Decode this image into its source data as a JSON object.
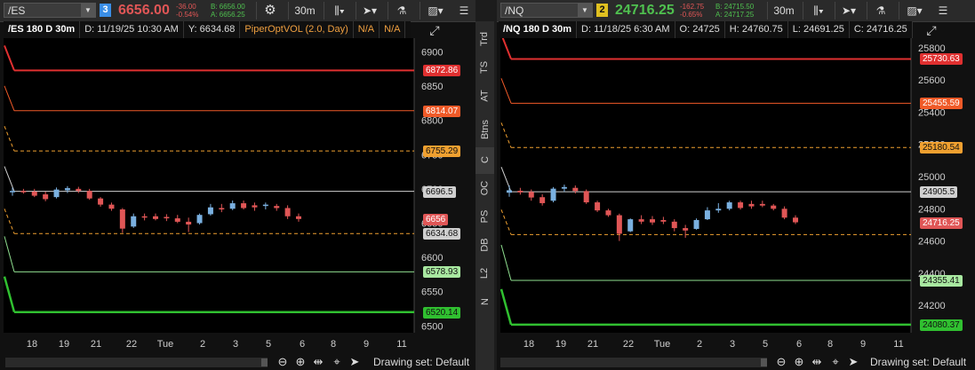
{
  "left": {
    "symbol": "/ES",
    "link_number": "3",
    "price": "6656.00",
    "change": "-36.00",
    "change_pct": "-0.54%",
    "bid": "B: 6656.00",
    "ask": "A: 6656.25",
    "timeframe": "30m",
    "info_title": "/ES 180 D 30m",
    "info_date": "D: 11/19/25 10:30 AM",
    "info_extra": "Y: 6634.68",
    "info_study": "PiperOptVOL (2.0, Day)",
    "info_na1": "N/A",
    "info_na2": "N/A",
    "y_ticks": [
      "6900",
      "6850",
      "6800",
      "6750",
      "6700",
      "6650",
      "6600",
      "6550",
      "6500"
    ],
    "x_ticks": [
      "18",
      "19",
      "21",
      "22",
      "Tue",
      "2",
      "3",
      "5",
      "6",
      "8",
      "9",
      "11"
    ],
    "price_tags": [
      "6872.86",
      "6814.07",
      "6755.29",
      "6696.5",
      "6656",
      "6634.68",
      "6578.93",
      "6520.14"
    ],
    "drawing_set": "Drawing set: Default"
  },
  "right": {
    "symbol": "/NQ",
    "link_number": "2",
    "price": "24716.25",
    "change": "-162.75",
    "change_pct": "-0.65%",
    "bid": "B: 24715.50",
    "ask": "A: 24717.25",
    "timeframe": "30m",
    "info_title": "/NQ 180 D 30m",
    "info_date": "D: 11/18/25 6:30 AM",
    "info_o": "O: 24725",
    "info_h": "H: 24760.75",
    "info_l": "L: 24691.25",
    "info_c": "C: 24716.25",
    "y_ticks": [
      "25800",
      "25600",
      "25400",
      "25200",
      "25000",
      "24800",
      "24600",
      "24400",
      "24200"
    ],
    "x_ticks": [
      "18",
      "19",
      "21",
      "22",
      "Tue",
      "2",
      "3",
      "5",
      "6",
      "8",
      "9",
      "11"
    ],
    "price_tags": [
      "25730.63",
      "25455.59",
      "25180.54",
      "24905.5",
      "24716.25",
      "24355.41",
      "24080.37"
    ],
    "drawing_set": "Drawing set: Default"
  },
  "side_tabs": [
    "Trd",
    "TS",
    "AT",
    "Btns",
    "C",
    "OC",
    "PS",
    "DB",
    "L2",
    "N"
  ],
  "colors": {
    "red": "#e03030",
    "orange": "#f05a28",
    "amber": "#f0a030",
    "grey": "#d0d0d0",
    "green": "#30c030",
    "lightgreen": "#90e090",
    "up": "#7ab0e0",
    "down": "#e05656"
  },
  "chart_data": [
    {
      "type": "candlestick",
      "title": "/ES 180 D 30m",
      "x_tick_labels": [
        "18",
        "19",
        "21",
        "22",
        "Tue",
        "2",
        "3",
        "5",
        "6",
        "8",
        "9",
        "11"
      ],
      "ylim": [
        6490,
        6920
      ],
      "levels": [
        {
          "value": 6872.86,
          "style": "red"
        },
        {
          "value": 6814.07,
          "style": "orange"
        },
        {
          "value": 6755.29,
          "style": "amber-dashed"
        },
        {
          "value": 6696.5,
          "style": "grey"
        },
        {
          "value": 6634.68,
          "style": "amber-dashed"
        },
        {
          "value": 6578.93,
          "style": "lightgreen"
        },
        {
          "value": 6520.14,
          "style": "green"
        }
      ],
      "last": 6656,
      "candles": [
        {
          "o": 6695,
          "h": 6702,
          "l": 6690,
          "c": 6697
        },
        {
          "o": 6697,
          "h": 6700,
          "l": 6693,
          "c": 6695
        },
        {
          "o": 6696,
          "h": 6700,
          "l": 6688,
          "c": 6690
        },
        {
          "o": 6692,
          "h": 6696,
          "l": 6682,
          "c": 6685
        },
        {
          "o": 6688,
          "h": 6702,
          "l": 6686,
          "c": 6699
        },
        {
          "o": 6698,
          "h": 6704,
          "l": 6694,
          "c": 6701
        },
        {
          "o": 6700,
          "h": 6703,
          "l": 6694,
          "c": 6697
        },
        {
          "o": 6697,
          "h": 6700,
          "l": 6684,
          "c": 6686
        },
        {
          "o": 6686,
          "h": 6688,
          "l": 6674,
          "c": 6677
        },
        {
          "o": 6677,
          "h": 6680,
          "l": 6668,
          "c": 6671
        },
        {
          "o": 6670,
          "h": 6672,
          "l": 6636,
          "c": 6642
        },
        {
          "o": 6645,
          "h": 6664,
          "l": 6643,
          "c": 6660
        },
        {
          "o": 6660,
          "h": 6664,
          "l": 6654,
          "c": 6658
        },
        {
          "o": 6660,
          "h": 6664,
          "l": 6654,
          "c": 6656
        },
        {
          "o": 6659,
          "h": 6663,
          "l": 6653,
          "c": 6657
        },
        {
          "o": 6657,
          "h": 6662,
          "l": 6650,
          "c": 6652
        },
        {
          "o": 6652,
          "h": 6658,
          "l": 6637,
          "c": 6648
        },
        {
          "o": 6650,
          "h": 6664,
          "l": 6648,
          "c": 6662
        },
        {
          "o": 6663,
          "h": 6678,
          "l": 6661,
          "c": 6673
        },
        {
          "o": 6672,
          "h": 6678,
          "l": 6666,
          "c": 6670
        },
        {
          "o": 6671,
          "h": 6683,
          "l": 6669,
          "c": 6679
        },
        {
          "o": 6679,
          "h": 6683,
          "l": 6670,
          "c": 6672
        },
        {
          "o": 6676,
          "h": 6680,
          "l": 6668,
          "c": 6673
        },
        {
          "o": 6675,
          "h": 6680,
          "l": 6670,
          "c": 6677
        },
        {
          "o": 6675,
          "h": 6678,
          "l": 6668,
          "c": 6672
        },
        {
          "o": 6672,
          "h": 6676,
          "l": 6656,
          "c": 6660
        },
        {
          "o": 6660,
          "h": 6664,
          "l": 6652,
          "c": 6656
        }
      ]
    },
    {
      "type": "candlestick",
      "title": "/NQ 180 D 30m",
      "x_tick_labels": [
        "18",
        "19",
        "21",
        "22",
        "Tue",
        "2",
        "3",
        "5",
        "6",
        "8",
        "9",
        "11"
      ],
      "ylim": [
        24030,
        25860
      ],
      "levels": [
        {
          "value": 25730.63,
          "style": "red"
        },
        {
          "value": 25455.59,
          "style": "orange"
        },
        {
          "value": 25180.54,
          "style": "amber-dashed"
        },
        {
          "value": 24905.5,
          "style": "grey"
        },
        {
          "value": 24640,
          "style": "amber-dashed"
        },
        {
          "value": 24355.41,
          "style": "lightgreen"
        },
        {
          "value": 24080.37,
          "style": "green"
        }
      ],
      "last": 24716.25,
      "candles": [
        {
          "o": 24900,
          "h": 24945,
          "l": 24875,
          "c": 24915
        },
        {
          "o": 24912,
          "h": 24930,
          "l": 24888,
          "c": 24902
        },
        {
          "o": 24905,
          "h": 24920,
          "l": 24850,
          "c": 24870
        },
        {
          "o": 24872,
          "h": 24890,
          "l": 24820,
          "c": 24835
        },
        {
          "o": 24850,
          "h": 24935,
          "l": 24840,
          "c": 24925
        },
        {
          "o": 24925,
          "h": 24950,
          "l": 24905,
          "c": 24935
        },
        {
          "o": 24930,
          "h": 24945,
          "l": 24895,
          "c": 24910
        },
        {
          "o": 24910,
          "h": 24920,
          "l": 24830,
          "c": 24840
        },
        {
          "o": 24840,
          "h": 24850,
          "l": 24780,
          "c": 24790
        },
        {
          "o": 24790,
          "h": 24800,
          "l": 24750,
          "c": 24760
        },
        {
          "o": 24760,
          "h": 24770,
          "l": 24600,
          "c": 24645
        },
        {
          "o": 24660,
          "h": 24740,
          "l": 24655,
          "c": 24735
        },
        {
          "o": 24735,
          "h": 24760,
          "l": 24705,
          "c": 24720
        },
        {
          "o": 24735,
          "h": 24755,
          "l": 24700,
          "c": 24715
        },
        {
          "o": 24730,
          "h": 24750,
          "l": 24705,
          "c": 24720
        },
        {
          "o": 24720,
          "h": 24735,
          "l": 24660,
          "c": 24680
        },
        {
          "o": 24680,
          "h": 24700,
          "l": 24620,
          "c": 24665
        },
        {
          "o": 24675,
          "h": 24740,
          "l": 24670,
          "c": 24730
        },
        {
          "o": 24735,
          "h": 24810,
          "l": 24730,
          "c": 24790
        },
        {
          "o": 24790,
          "h": 24835,
          "l": 24775,
          "c": 24800
        },
        {
          "o": 24800,
          "h": 24850,
          "l": 24790,
          "c": 24840
        },
        {
          "o": 24840,
          "h": 24850,
          "l": 24795,
          "c": 24805
        },
        {
          "o": 24830,
          "h": 24850,
          "l": 24800,
          "c": 24815
        },
        {
          "o": 24830,
          "h": 24850,
          "l": 24810,
          "c": 24820
        },
        {
          "o": 24820,
          "h": 24830,
          "l": 24790,
          "c": 24800
        },
        {
          "o": 24800,
          "h": 24815,
          "l": 24735,
          "c": 24745
        },
        {
          "o": 24745,
          "h": 24760,
          "l": 24705,
          "c": 24716
        }
      ]
    }
  ]
}
